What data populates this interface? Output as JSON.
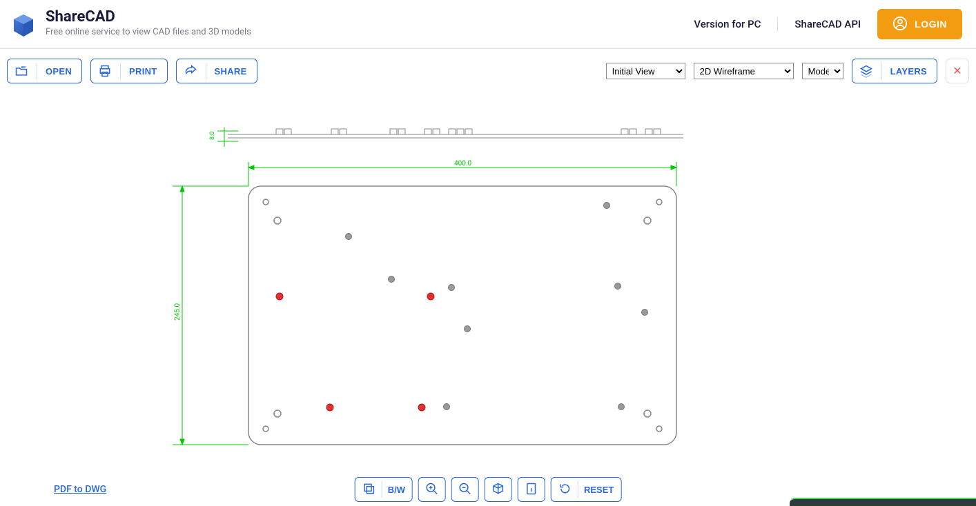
{
  "brand": {
    "title": "ShareCAD",
    "subtitle": "Free online service to view CAD files and 3D models"
  },
  "header": {
    "version_pc": "Version for PC",
    "api": "ShareCAD API",
    "login": "LOGIN"
  },
  "toolbar": {
    "open": "OPEN",
    "print": "PRINT",
    "share": "SHARE",
    "layers": "LAYERS",
    "view_select": "Initial View",
    "style_select": "2D Wireframe",
    "model_select": "Model"
  },
  "bottom": {
    "pdf_link": "PDF to DWG",
    "bw": "B/W",
    "reset": "RESET"
  },
  "drawing": {
    "width_dim": "400.0",
    "height_dim": "245.0",
    "top_dim": "8.0"
  }
}
